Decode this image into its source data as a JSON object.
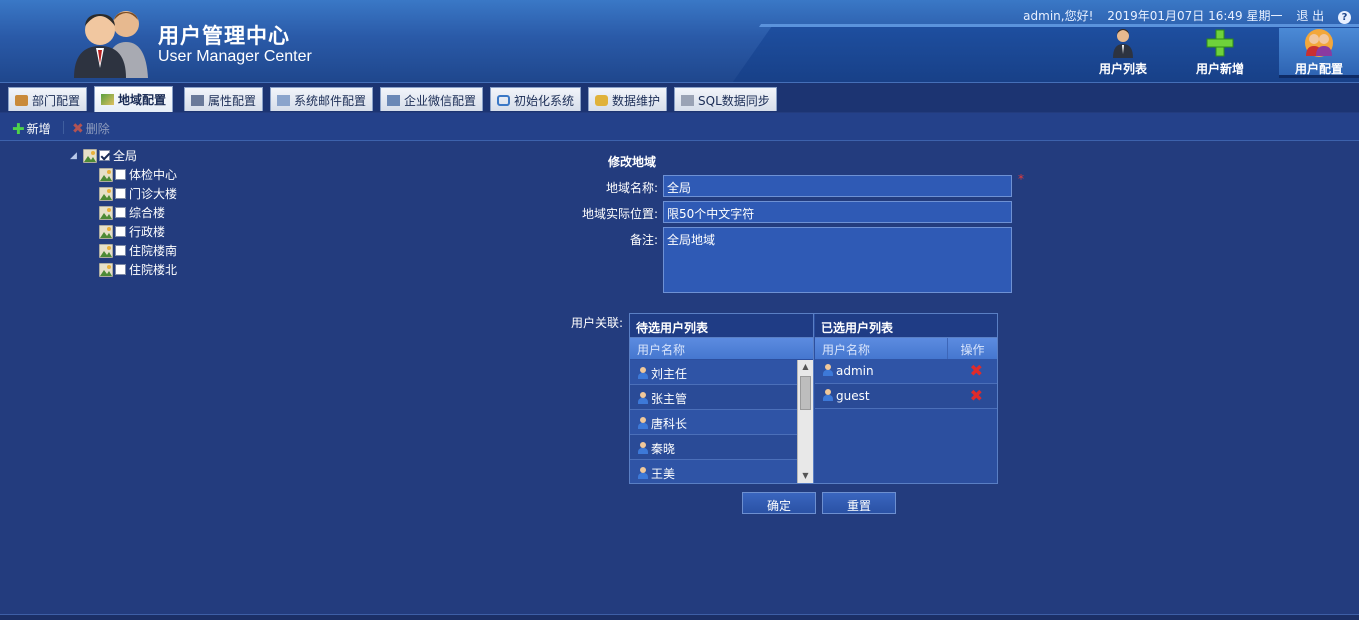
{
  "header": {
    "title": "用户管理中心",
    "subtitle": "User Manager Center",
    "greeting": "admin,您好!",
    "datetime": "2019年01月07日 16:49 星期一",
    "logout": "退 出",
    "help": "?",
    "nav": [
      {
        "label": "用户列表",
        "icon": "user-list-icon"
      },
      {
        "label": "用户新增",
        "icon": "add-user-icon"
      },
      {
        "label": "用户配置",
        "icon": "user-config-icon",
        "active": true
      }
    ]
  },
  "tabs": [
    {
      "label": "部门配置"
    },
    {
      "label": "地域配置",
      "active": true
    },
    {
      "label": "属性配置"
    },
    {
      "label": "系统邮件配置"
    },
    {
      "label": "企业微信配置"
    },
    {
      "label": "初始化系统"
    },
    {
      "label": "数据维护"
    },
    {
      "label": "SQL数据同步"
    }
  ],
  "toolbar": {
    "add_label": "新增",
    "delete_label": "删除"
  },
  "tree": {
    "root": {
      "label": "全局",
      "checked": true
    },
    "children": [
      {
        "label": "体检中心",
        "checked": false
      },
      {
        "label": "门诊大楼",
        "checked": false
      },
      {
        "label": "综合楼",
        "checked": false
      },
      {
        "label": "行政楼",
        "checked": false
      },
      {
        "label": "住院楼南",
        "checked": false
      },
      {
        "label": "住院楼北",
        "checked": false
      }
    ]
  },
  "form": {
    "title": "修改地域",
    "name_label": "地域名称:",
    "name_value": "全局",
    "required_mark": "*",
    "location_label": "地域实际位置:",
    "location_value": "限50个中文字符",
    "remark_label": "备注:",
    "remark_value": "全局地域",
    "users_label": "用户关联:"
  },
  "pending": {
    "title": "待选用户列表",
    "column": "用户名称",
    "users": [
      "刘主任",
      "张主管",
      "唐科长",
      "秦晓",
      "王美"
    ]
  },
  "selected": {
    "title": "已选用户列表",
    "column": "用户名称",
    "action_column": "操作",
    "users": [
      "admin",
      "guest"
    ]
  },
  "buttons": {
    "confirm": "确定",
    "reset": "重置"
  },
  "colors": {
    "background": "#233c7e",
    "header": "#2a5aa8",
    "accent": "#4ed24a",
    "delete": "#e02b2b"
  }
}
